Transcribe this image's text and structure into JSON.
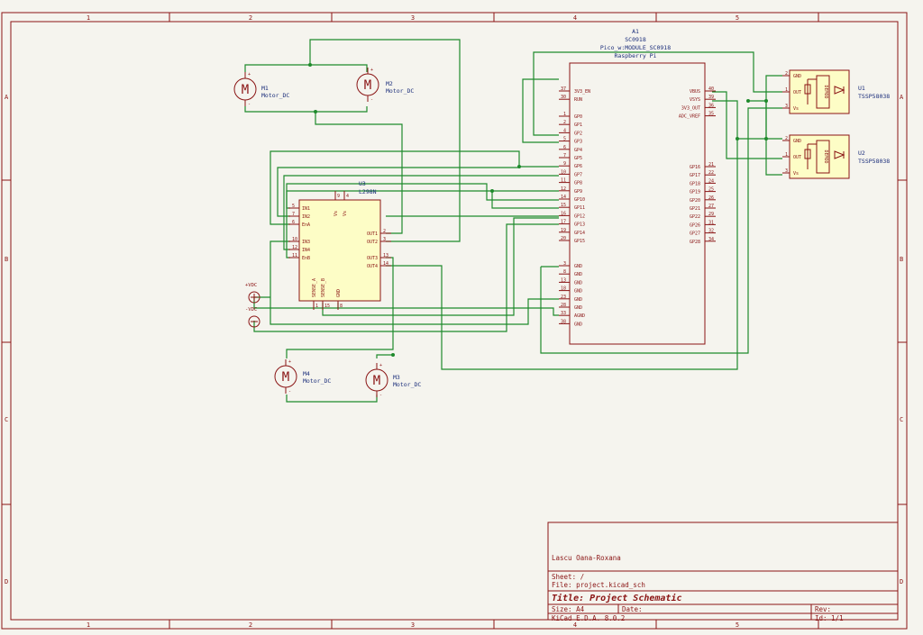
{
  "border": {
    "columns": [
      "1",
      "2",
      "3",
      "4",
      "5"
    ],
    "rows": [
      "A",
      "B",
      "C",
      "D"
    ]
  },
  "title_block": {
    "author": "Lascu Oana-Roxana",
    "sheet": "Sheet: /",
    "file": "File: project.kicad_sch",
    "title": "Title: Project Schematic",
    "size": "Size: A4",
    "date": "Date:",
    "rev": "Rev:",
    "tool": "KiCad E.D.A. 8.0.2",
    "id": "Id: 1/1"
  },
  "pico": {
    "ref": "A1",
    "value": "SC0918",
    "footprint": "Pico_w:MODULE_SC0918",
    "name": "Raspberry Pi",
    "left_pins": [
      {
        "num": "37",
        "name": "3V3_EN"
      },
      {
        "num": "30",
        "name": "RUN"
      },
      {
        "num": "1",
        "name": "GP0"
      },
      {
        "num": "2",
        "name": "GP1"
      },
      {
        "num": "4",
        "name": "GP2"
      },
      {
        "num": "5",
        "name": "GP3"
      },
      {
        "num": "6",
        "name": "GP4"
      },
      {
        "num": "7",
        "name": "GP5"
      },
      {
        "num": "9",
        "name": "GP6"
      },
      {
        "num": "10",
        "name": "GP7"
      },
      {
        "num": "11",
        "name": "GP8"
      },
      {
        "num": "12",
        "name": "GP9"
      },
      {
        "num": "14",
        "name": "GP10"
      },
      {
        "num": "15",
        "name": "GP11"
      },
      {
        "num": "16",
        "name": "GP12"
      },
      {
        "num": "17",
        "name": "GP13"
      },
      {
        "num": "19",
        "name": "GP14"
      },
      {
        "num": "20",
        "name": "GP15"
      },
      {
        "num": "3",
        "name": "GND"
      },
      {
        "num": "8",
        "name": "GND"
      },
      {
        "num": "13",
        "name": "GND"
      },
      {
        "num": "18",
        "name": "GND"
      },
      {
        "num": "23",
        "name": "GND"
      },
      {
        "num": "28",
        "name": "GND"
      },
      {
        "num": "33",
        "name": "AGND"
      },
      {
        "num": "38",
        "name": "GND"
      }
    ],
    "right_pins": [
      {
        "num": "40",
        "name": "VBUS"
      },
      {
        "num": "39",
        "name": "VSYS"
      },
      {
        "num": "36",
        "name": "3V3_OUT"
      },
      {
        "num": "35",
        "name": "ADC_VREF"
      },
      {
        "num": "21",
        "name": "GP16"
      },
      {
        "num": "22",
        "name": "GP17"
      },
      {
        "num": "24",
        "name": "GP18"
      },
      {
        "num": "25",
        "name": "GP19"
      },
      {
        "num": "26",
        "name": "GP20"
      },
      {
        "num": "27",
        "name": "GP21"
      },
      {
        "num": "29",
        "name": "GP22"
      },
      {
        "num": "31",
        "name": "GP26"
      },
      {
        "num": "32",
        "name": "GP27"
      },
      {
        "num": "34",
        "name": "GP28"
      }
    ]
  },
  "l298": {
    "ref": "U3",
    "value": "L298N",
    "left_pins": [
      {
        "num": "5",
        "name": "IN1"
      },
      {
        "num": "7",
        "name": "IN2"
      },
      {
        "num": "6",
        "name": "EnA"
      },
      {
        "num": "10",
        "name": "IN3"
      },
      {
        "num": "12",
        "name": "IN4"
      },
      {
        "num": "11",
        "name": "EnB"
      }
    ],
    "right_pins": [
      {
        "num": "2",
        "name": "OUT1"
      },
      {
        "num": "3",
        "name": "OUT2"
      },
      {
        "num": "13",
        "name": "OUT3"
      },
      {
        "num": "14",
        "name": "OUT4"
      }
    ],
    "top_pins": [
      {
        "num": "9",
        "name": "Vs"
      },
      {
        "num": "4",
        "name": "Vs"
      }
    ],
    "bottom_pins": [
      {
        "num": "1",
        "name": "SENSE_A"
      },
      {
        "num": "15",
        "name": "SENSE_B"
      },
      {
        "num": "8",
        "name": "GND"
      }
    ]
  },
  "motors": [
    {
      "ref": "M1",
      "value": "Motor_DC"
    },
    {
      "ref": "M2",
      "value": "Motor_DC"
    },
    {
      "ref": "M4",
      "value": "Motor_DC"
    },
    {
      "ref": "M3",
      "value": "Motor_DC"
    }
  ],
  "motor_glyph": "M",
  "power": {
    "pos": "+VDC",
    "neg": "-VDC"
  },
  "ir": [
    {
      "ref": "U1",
      "value": "TSSP58038",
      "pins": [
        "GND",
        "OUT",
        "Vs"
      ],
      "nums": [
        "2",
        "1",
        "3"
      ],
      "block": "DEMOD"
    },
    {
      "ref": "U2",
      "value": "TSSP58038",
      "pins": [
        "GND",
        "OUT",
        "Vs"
      ],
      "nums": [
        "2",
        "1",
        "3"
      ],
      "block": "DEMOD"
    }
  ]
}
